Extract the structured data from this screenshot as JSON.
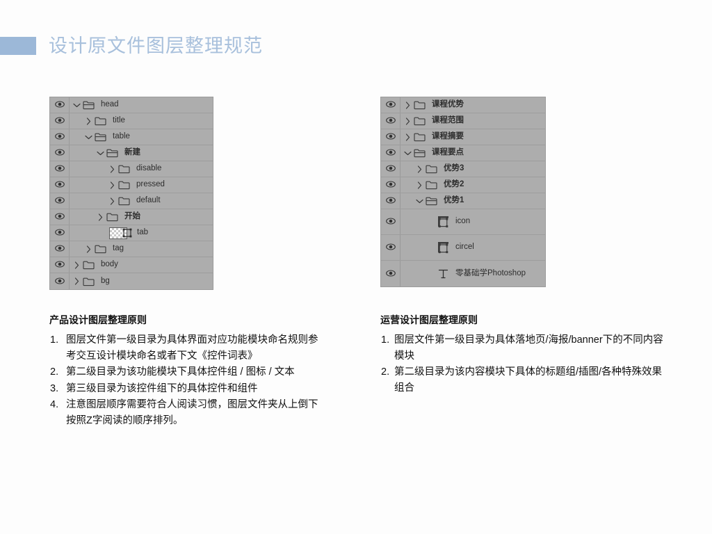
{
  "header": {
    "title": "设计原文件图层整理规范",
    "accent_color": "#9cb8d8",
    "title_color": "#a8c0dc"
  },
  "panels": {
    "left": {
      "name": "product-layer-panel",
      "rows": [
        {
          "label": "head",
          "indent": 0,
          "icon": "folder-open-icon",
          "twisty": "chevron-down-icon",
          "visible_icon": "eye-icon",
          "script": "latin"
        },
        {
          "label": "title",
          "indent": 1,
          "icon": "folder-closed-icon",
          "twisty": "chevron-right-icon",
          "visible_icon": "eye-icon",
          "script": "latin"
        },
        {
          "label": "table",
          "indent": 1,
          "icon": "folder-open-icon",
          "twisty": "chevron-down-icon",
          "visible_icon": "eye-icon",
          "script": "latin"
        },
        {
          "label": "新建",
          "indent": 2,
          "icon": "folder-open-icon",
          "twisty": "chevron-down-icon",
          "visible_icon": "eye-icon",
          "script": "cjk"
        },
        {
          "label": "disable",
          "indent": 3,
          "icon": "folder-closed-icon",
          "twisty": "chevron-right-icon",
          "visible_icon": "eye-icon",
          "script": "latin"
        },
        {
          "label": "pressed",
          "indent": 3,
          "icon": "folder-closed-icon",
          "twisty": "chevron-right-icon",
          "visible_icon": "eye-icon",
          "script": "latin"
        },
        {
          "label": "default",
          "indent": 3,
          "icon": "folder-closed-icon",
          "twisty": "chevron-right-icon",
          "visible_icon": "eye-icon",
          "script": "latin"
        },
        {
          "label": "开始",
          "indent": 2,
          "icon": "folder-closed-icon",
          "twisty": "chevron-right-icon",
          "visible_icon": "eye-icon",
          "script": "cjk"
        },
        {
          "label": "tab",
          "indent": 2,
          "icon": "transparent-thumbnail-icon",
          "twisty": "none",
          "visible_icon": "eye-icon",
          "script": "latin"
        },
        {
          "label": "tag",
          "indent": 1,
          "icon": "folder-closed-icon",
          "twisty": "chevron-right-icon",
          "visible_icon": "eye-icon",
          "script": "latin"
        },
        {
          "label": "body",
          "indent": 0,
          "icon": "folder-closed-icon",
          "twisty": "chevron-right-icon",
          "visible_icon": "eye-icon",
          "script": "latin"
        },
        {
          "label": "bg",
          "indent": 0,
          "icon": "folder-closed-icon",
          "twisty": "chevron-right-icon",
          "visible_icon": "eye-icon",
          "script": "latin"
        }
      ]
    },
    "right": {
      "name": "marketing-layer-panel",
      "rows": [
        {
          "label": "课程优势",
          "indent": 0,
          "icon": "folder-closed-icon",
          "twisty": "chevron-right-icon",
          "visible_icon": "eye-icon",
          "script": "cjk",
          "tall": false
        },
        {
          "label": "课程范围",
          "indent": 0,
          "icon": "folder-closed-icon",
          "twisty": "chevron-right-icon",
          "visible_icon": "eye-icon",
          "script": "cjk",
          "tall": false
        },
        {
          "label": "课程摘要",
          "indent": 0,
          "icon": "folder-closed-icon",
          "twisty": "chevron-right-icon",
          "visible_icon": "eye-icon",
          "script": "cjk",
          "tall": false
        },
        {
          "label": "课程要点",
          "indent": 0,
          "icon": "folder-open-icon",
          "twisty": "chevron-down-icon",
          "visible_icon": "eye-icon",
          "script": "cjk",
          "tall": false
        },
        {
          "label": "优势3",
          "indent": 1,
          "icon": "folder-closed-icon",
          "twisty": "chevron-right-icon",
          "visible_icon": "eye-icon",
          "script": "cjk",
          "tall": false
        },
        {
          "label": "优势2",
          "indent": 1,
          "icon": "folder-closed-icon",
          "twisty": "chevron-right-icon",
          "visible_icon": "eye-icon",
          "script": "cjk",
          "tall": false
        },
        {
          "label": "优势1",
          "indent": 1,
          "icon": "folder-open-icon",
          "twisty": "chevron-down-icon",
          "visible_icon": "eye-icon",
          "script": "cjk",
          "tall": false
        },
        {
          "label": "icon",
          "indent": 2,
          "icon": "smart-object-icon",
          "twisty": "none",
          "visible_icon": "eye-icon",
          "script": "latin",
          "tall": true
        },
        {
          "label": "circel",
          "indent": 2,
          "icon": "smart-object-icon",
          "twisty": "none",
          "visible_icon": "eye-icon",
          "script": "latin",
          "tall": true
        },
        {
          "label": "零基础学Photoshop",
          "indent": 2,
          "icon": "text-layer-icon",
          "twisty": "none",
          "visible_icon": "eye-icon",
          "script": "mixed",
          "tall": true
        }
      ]
    }
  },
  "columns": {
    "left": {
      "heading": "产品设计图层整理原则",
      "items": [
        "图层文件第一级目录为具体界面对应功能模块命名规则参考交互设计模块命名或者下文《控件词表》",
        "第二级目录为该功能模块下具体控件组 / 图标 / 文本",
        "第三级目录为该控件组下的具体控件和组件",
        "注意图层顺序需要符合人阅读习惯，图层文件夹从上倒下按照Z字阅读的顺序排列。"
      ]
    },
    "right": {
      "heading": "运营设计图层整理原则",
      "items": [
        "图层文件第一级目录为具体落地页/海报/banner下的不同内容模块",
        "第二级目录为该内容模块下具体的标题组/插图/各种特殊效果组合"
      ]
    }
  }
}
